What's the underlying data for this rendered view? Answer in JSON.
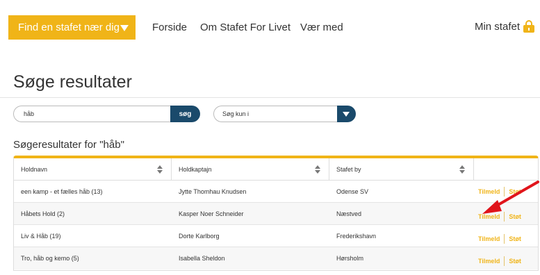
{
  "nav": {
    "find_label": "Find en stafet nær dig",
    "links": [
      "Forside",
      "Om Stafet For Livet",
      "Vær med"
    ],
    "min_stafet": "Min stafet"
  },
  "page_title": "Søge resultater",
  "search": {
    "value": "håb",
    "button_label": "søg"
  },
  "filter": {
    "selected": "Søg kun i"
  },
  "results_heading": "Søgeresultater for \"håb\"",
  "table": {
    "headers": [
      "Holdnavn",
      "Holdkaptajn",
      "Stafet by"
    ],
    "rows": [
      {
        "holdnavn": "een kamp - et fælles håb (13)",
        "kaptajn": "Jytte Thomhau Knudsen",
        "by": "Odense SV"
      },
      {
        "holdnavn": "Håbets Hold (2)",
        "kaptajn": "Kasper Noer Schneider",
        "by": "Næstved"
      },
      {
        "holdnavn": "Liv & Håb (19)",
        "kaptajn": "Dorte Karlborg",
        "by": "Frederikshavn"
      },
      {
        "holdnavn": "Tro, håb og kemo (5)",
        "kaptajn": "Isabella Sheldon",
        "by": "Hørsholm"
      }
    ],
    "action_tilmeld": "Tilmeld",
    "action_stot": "Støt"
  },
  "colors": {
    "accent": "#f0b418",
    "navy": "#1a4a6b",
    "annotation": "#e0141b"
  }
}
